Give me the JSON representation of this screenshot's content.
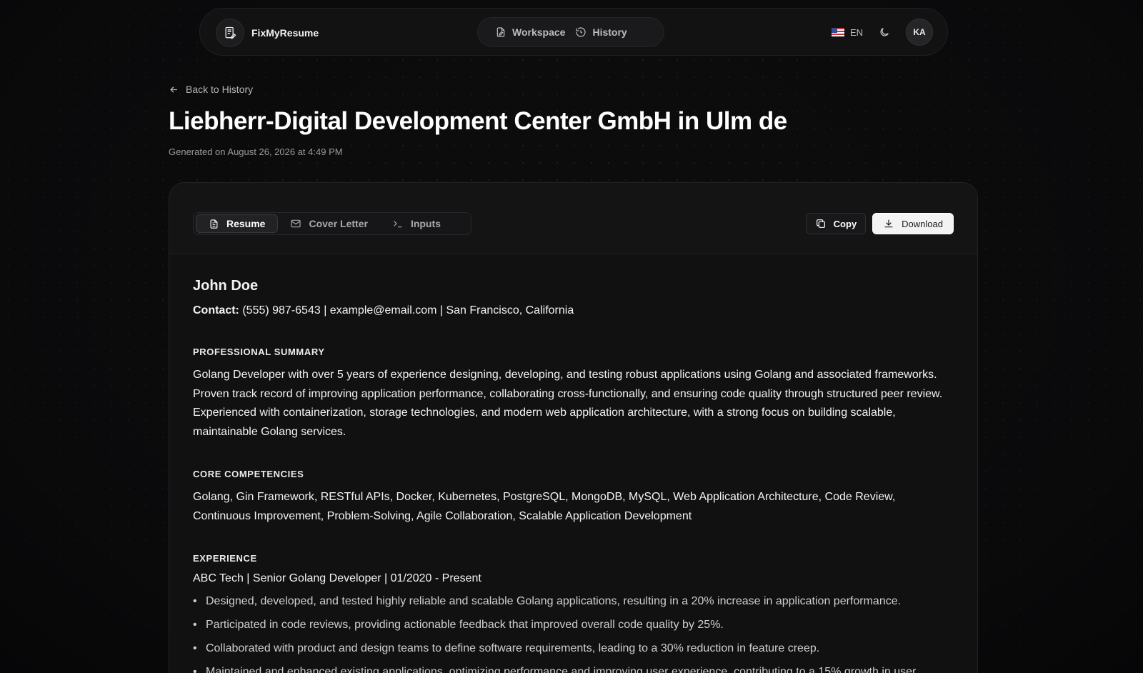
{
  "app": {
    "brand": "FixMyResume",
    "nav": [
      {
        "label": "Workspace",
        "icon": "file-pen-icon"
      },
      {
        "label": "History",
        "icon": "history-icon"
      }
    ],
    "language": "EN",
    "avatar_initials": "KA"
  },
  "header": {
    "back_label": "Back to History",
    "title": "Liebherr-Digital Development Center GmbH in Ulm de",
    "generated": "Generated on August 26, 2026 at 4:49 PM"
  },
  "tabs": [
    {
      "label": "Resume",
      "active": true
    },
    {
      "label": "Cover Letter",
      "active": false
    },
    {
      "label": "Inputs",
      "active": false
    }
  ],
  "actions": {
    "copy": "Copy",
    "download": "Download"
  },
  "resume": {
    "name": "John Doe",
    "contact_label": "Contact:",
    "contact_value": " (555) 987-6543 | example@email.com | San Francisco, California",
    "summary_heading": "PROFESSIONAL SUMMARY",
    "summary": "Golang Developer with over 5 years of experience designing, developing, and testing robust applications using Golang and associated frameworks. Proven track record of improving application performance, collaborating cross-functionally, and ensuring code quality through structured peer review. Experienced with containerization, storage technologies, and modern web application architecture, with a strong focus on building scalable, maintainable Golang services.",
    "competencies_heading": "CORE COMPETENCIES",
    "competencies": "Golang, Gin Framework, RESTful APIs, Docker, Kubernetes, PostgreSQL, MongoDB, MySQL, Web Application Architecture, Code Review, Continuous Improvement, Problem-Solving, Agile Collaboration, Scalable Application Development",
    "experience_heading": "EXPERIENCE",
    "job_title": "ABC Tech | Senior Golang Developer | 01/2020 - Present",
    "bullets": [
      "Designed, developed, and tested highly reliable and scalable Golang applications, resulting in a 20% increase in application performance.",
      "Participated in code reviews, providing actionable feedback that improved overall code quality by 25%.",
      "Collaborated with product and design teams to define software requirements, leading to a 30% reduction in feature creep.",
      "Maintained and enhanced existing applications, optimizing performance and improving user experience, contributing to a 15% growth in user"
    ]
  }
}
